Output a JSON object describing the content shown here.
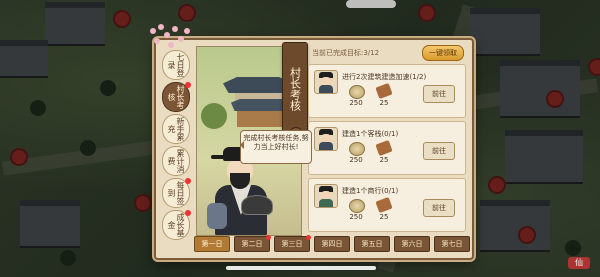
{
  "hud": {
    "corner_badge": "仙"
  },
  "side_tabs": [
    {
      "label": "七日登录",
      "active": false,
      "dot": false
    },
    {
      "label": "村长考核",
      "active": true,
      "dot": true
    },
    {
      "label": "新手累充",
      "active": false,
      "dot": false
    },
    {
      "label": "累计消费",
      "active": false,
      "dot": false
    },
    {
      "label": "每日签到",
      "active": false,
      "dot": true
    },
    {
      "label": "成长基金",
      "active": false,
      "dot": true
    }
  ],
  "title": "村长考核",
  "title_mark": "!",
  "speech": "完成村长考核任务,努力当上好村长!",
  "progress_label": "当前已完成目标:3/12",
  "bulk_button": "一键领取",
  "tasks": [
    {
      "name": "进行2次建筑建造加速(1/2)",
      "rewards": [
        {
          "icon": "coin-icon",
          "value": "250"
        },
        {
          "icon": "cloth-icon",
          "value": "25"
        }
      ],
      "button": "前往"
    },
    {
      "name": "建造1个客栈(0/1)",
      "rewards": [
        {
          "icon": "coin-icon",
          "value": "250"
        },
        {
          "icon": "cloth-icon",
          "value": "25"
        }
      ],
      "button": "前往"
    },
    {
      "name": "建造1个商行(0/1)",
      "rewards": [
        {
          "icon": "coin-icon",
          "value": "250"
        },
        {
          "icon": "cloth-icon",
          "value": "25"
        }
      ],
      "button": "前往"
    }
  ],
  "days": [
    {
      "label": "第一日",
      "active": true,
      "dot": false
    },
    {
      "label": "第二日",
      "active": false,
      "dot": true
    },
    {
      "label": "第三日",
      "active": false,
      "dot": true
    },
    {
      "label": "第四日",
      "active": false,
      "dot": false
    },
    {
      "label": "第五日",
      "active": false,
      "dot": false
    },
    {
      "label": "第六日",
      "active": false,
      "dot": false
    },
    {
      "label": "第七日",
      "active": false,
      "dot": false
    }
  ]
}
